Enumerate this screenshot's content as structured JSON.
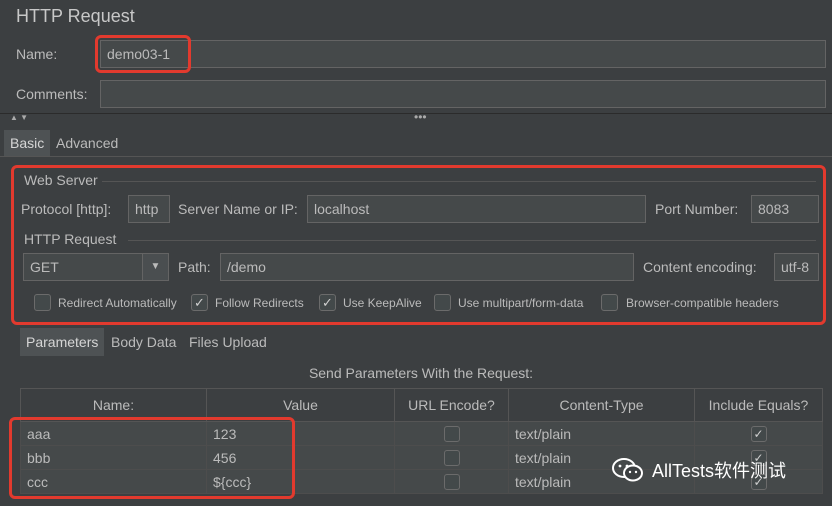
{
  "panel": {
    "title": "HTTP Request"
  },
  "name_field": {
    "label": "Name:",
    "value": "demo03-1"
  },
  "comments_field": {
    "label": "Comments:",
    "value": ""
  },
  "tabs": [
    {
      "label": "Basic",
      "active": true
    },
    {
      "label": "Advanced",
      "active": false
    }
  ],
  "web_server": {
    "group_title": "Web Server",
    "protocol_label": "Protocol [http]:",
    "protocol_value": "http",
    "server_label": "Server Name or IP:",
    "server_value": "localhost",
    "port_label": "Port Number:",
    "port_value": "8083"
  },
  "http_request": {
    "group_title": "HTTP Request",
    "method": "GET",
    "path_label": "Path:",
    "path_value": "/demo",
    "encoding_label": "Content encoding:",
    "encoding_value": "utf-8"
  },
  "options": [
    {
      "label": "Redirect Automatically",
      "checked": false
    },
    {
      "label": "Follow Redirects",
      "checked": true
    },
    {
      "label": "Use KeepAlive",
      "checked": true
    },
    {
      "label": "Use multipart/form-data",
      "checked": false
    },
    {
      "label": "Browser-compatible headers",
      "checked": false
    }
  ],
  "sub_tabs": [
    {
      "label": "Parameters",
      "active": true
    },
    {
      "label": "Body Data",
      "active": false
    },
    {
      "label": "Files Upload",
      "active": false
    }
  ],
  "params_caption": "Send Parameters With the Request:",
  "params_table": {
    "headers": [
      "Name:",
      "Value",
      "URL Encode?",
      "Content-Type",
      "Include Equals?"
    ],
    "rows": [
      {
        "name": "aaa",
        "value": "123",
        "url_encode": false,
        "content_type": "text/plain",
        "include_equals": true
      },
      {
        "name": "bbb",
        "value": "456",
        "url_encode": false,
        "content_type": "text/plain",
        "include_equals": true
      },
      {
        "name": "ccc",
        "value": "${ccc}",
        "url_encode": false,
        "content_type": "text/plain",
        "include_equals": true
      }
    ]
  },
  "watermark": {
    "text": "AllTests软件测试",
    "icon": "wechat-icon"
  },
  "colors": {
    "highlight": "#e23a2e",
    "background": "#3c3f41"
  }
}
